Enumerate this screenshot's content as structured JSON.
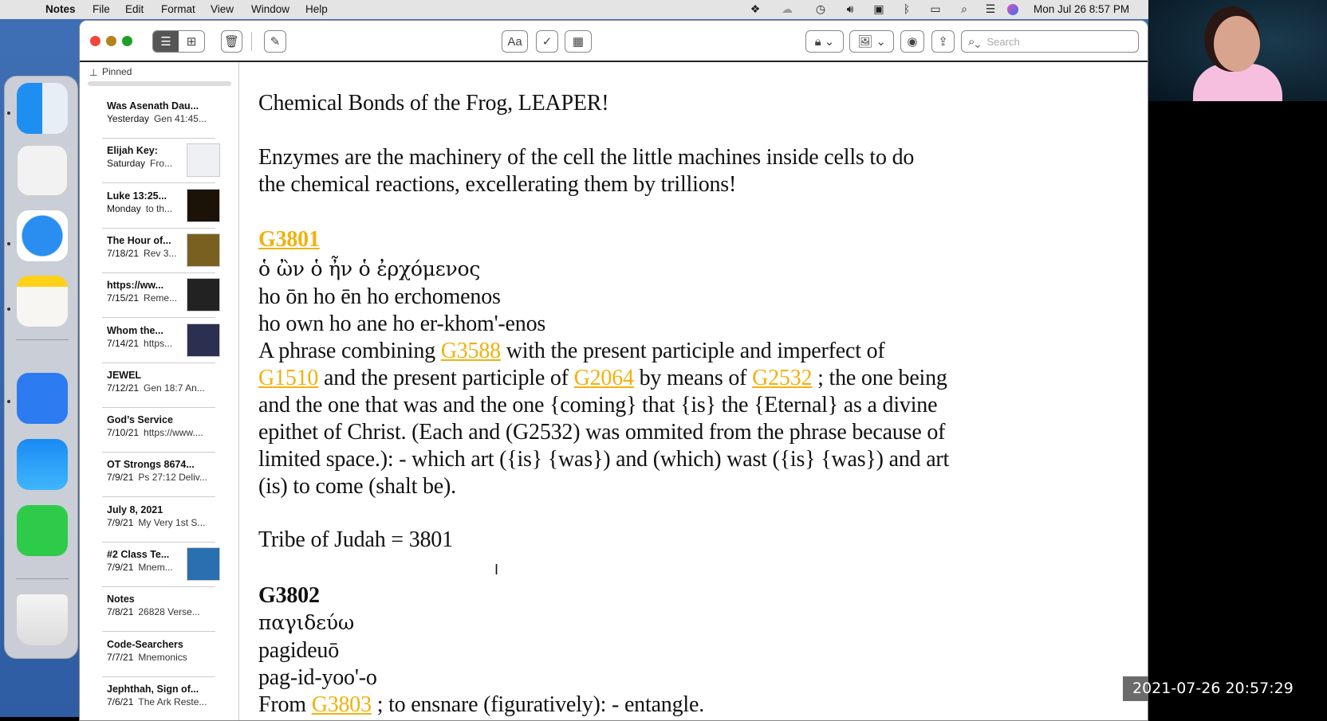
{
  "menubar": {
    "app": "Notes",
    "items": [
      "File",
      "Edit",
      "Format",
      "View",
      "Window",
      "Help"
    ],
    "clock": "Mon Jul 26  8:57 PM",
    "status_icons": [
      "dropbox-icon",
      "icloud-icon",
      "time-machine-icon",
      "volume-icon",
      "keyboard-input-icon",
      "bluetooth-icon",
      "battery-icon",
      "spotlight-icon",
      "control-center-icon",
      "siri-icon"
    ]
  },
  "toolbar": {
    "search_placeholder": "Search",
    "format_label": "Aa"
  },
  "sidebar": {
    "section": "Pinned",
    "notes": [
      {
        "title": "Was Asenath Dau...",
        "date": "Yesterday",
        "snippet": "Gen 41:45...",
        "thumb": false
      },
      {
        "title": "Elijah Key:",
        "date": "Saturday",
        "snippet": "Fro...",
        "thumb": true
      },
      {
        "title": "Luke 13:25...",
        "date": "Monday",
        "snippet": "to th...",
        "thumb": true
      },
      {
        "title": "The Hour of...",
        "date": "7/18/21",
        "snippet": "Rev 3...",
        "thumb": true
      },
      {
        "title": "https://ww...",
        "date": "7/15/21",
        "snippet": "Reme...",
        "thumb": true
      },
      {
        "title": "Whom the...",
        "date": "7/14/21",
        "snippet": "https...",
        "thumb": true
      },
      {
        "title": "JEWEL",
        "date": "7/12/21",
        "snippet": "Gen 18:7 An...",
        "thumb": false
      },
      {
        "title": "God’s Service",
        "date": "7/10/21",
        "snippet": "https://www....",
        "thumb": false
      },
      {
        "title": "OT Strongs 8674...",
        "date": "7/9/21",
        "snippet": "Ps 27:12 Deliv...",
        "thumb": false
      },
      {
        "title": "July 8, 2021",
        "date": "7/9/21",
        "snippet": "My Very 1st S...",
        "thumb": false
      },
      {
        "title": "#2 Class Te...",
        "date": "7/9/21",
        "snippet": "Mnem...",
        "thumb": true
      },
      {
        "title": "Notes",
        "date": "7/8/21",
        "snippet": "26828 Verse...",
        "thumb": false
      },
      {
        "title": "Code-Searchers",
        "date": "7/7/21",
        "snippet": "Mnemonics",
        "thumb": false
      },
      {
        "title": "Jephthah, Sign of...",
        "date": "7/6/21",
        "snippet": "The Ark Reste...",
        "thumb": false
      }
    ]
  },
  "note": {
    "title": "Chemical Bonds of the Frog, LEAPER!",
    "p1": [
      "Enzymes are the machinery of the cell the little machines inside cells to do",
      "the chemical reactions, excellerating them by trillions!"
    ],
    "g3801": {
      "id": "G3801",
      "greek": "ὁ ὢν ὁ ἦν ὁ ἐρχόμενος",
      "translit": "ho ōn ho ēn ho erchomenos",
      "pron": "ho own ho ane ho er-khom'-enos",
      "def_a": "A phrase combining ",
      "link1": "G3588",
      "def_b": " with the present participle and imperfect of",
      "link2": "G1510",
      "def_c": " and the present participle of ",
      "link3": "G2064",
      "def_d": " by means of ",
      "link4": "G2532",
      "def_e": " ; the one being",
      "def_lines": [
        "and the one that was and the one {coming} that {is} the {Eternal} as a divine",
        "epithet of Christ. (Each and (G2532) was ommited from the phrase because of",
        "limited space.): - which art ({is} {was}) and (which) wast ({is} {was}) and art",
        "(is) to come (shalt be)."
      ]
    },
    "tribe": "Tribe of Judah = 3801",
    "g3802": {
      "id": "G3802",
      "greek": "παγιδεύω",
      "translit": "pagideuō",
      "pron": "pag-id-yoo'-o",
      "from": "From ",
      "link": "G3803",
      "def": " ; to ensnare (figuratively): - entangle."
    }
  },
  "overlay": {
    "timestamp": "2021-07-26 20:57:29"
  },
  "colors": {
    "link": "#f2b10c",
    "desktop": "#3f6fb4"
  }
}
